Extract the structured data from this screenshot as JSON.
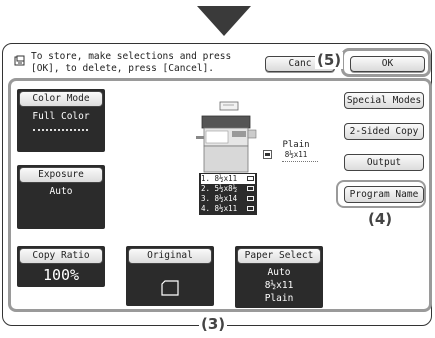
{
  "message": {
    "line1": "To store, make selections and press",
    "line2": "[OK], to delete, press [Cancel]."
  },
  "header": {
    "cancel_label": "Canc",
    "ok_label": "OK"
  },
  "callouts": {
    "c5": "(5)",
    "c4": "(4)",
    "c3": "(3)"
  },
  "color_mode": {
    "label": "Color Mode",
    "value": "Full Color"
  },
  "exposure": {
    "label": "Exposure",
    "value": "Auto"
  },
  "copy_ratio": {
    "label": "Copy Ratio",
    "value": "100%"
  },
  "original": {
    "label": "Original"
  },
  "paper_select": {
    "label": "Paper Select",
    "line1": "Auto",
    "line2": "8½x11",
    "line3": "Plain"
  },
  "right_buttons": {
    "special_modes": "Special Modes",
    "two_sided": "2-Sided Copy",
    "output": "Output",
    "program_name": "Program Name"
  },
  "machine": {
    "bypass_type": "Plain",
    "bypass_size": "8½x11",
    "trays": [
      "1. 8½x11",
      "2. 5½x8½",
      "3. 8½x14",
      "4. 8½x11"
    ],
    "selected_tray": 1
  },
  "icons": [
    "store-message-icon",
    "original-orientation-icon",
    "bypass-tray-icon",
    "tray-paper-icon"
  ]
}
